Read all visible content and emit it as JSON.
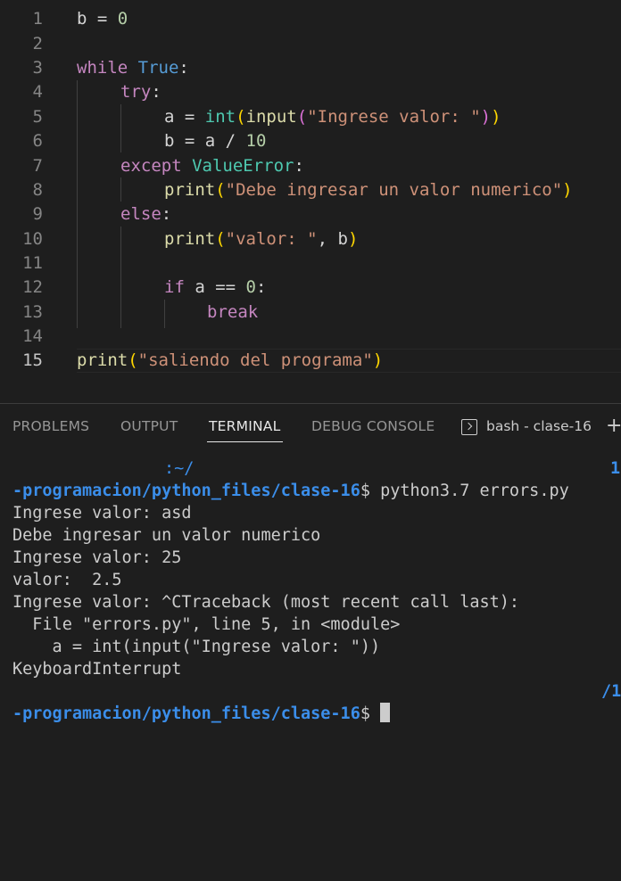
{
  "editor": {
    "line_numbers": [
      "1",
      "2",
      "3",
      "4",
      "5",
      "6",
      "7",
      "8",
      "9",
      "10",
      "11",
      "12",
      "13",
      "14",
      "15"
    ],
    "active_line": "15",
    "lines": {
      "l1": {
        "b": "b",
        "eq": " = ",
        "zero": "0"
      },
      "l3": {
        "kw": "while",
        "sp": " ",
        "true": "True",
        "colon": ":"
      },
      "l4": {
        "kw": "try",
        "colon": ":"
      },
      "l5": {
        "a": "a = ",
        "int": "int",
        "p1": "(",
        "input": "input",
        "p2": "(",
        "str": "\"Ingrese valor: \"",
        "p2c": ")",
        "p1c": ")"
      },
      "l6": {
        "text": "b = a / ",
        "num": "10"
      },
      "l7": {
        "kw": "except",
        "sp": " ",
        "cls": "ValueError",
        "colon": ":"
      },
      "l8": {
        "fn": "print",
        "p1": "(",
        "str": "\"Debe ingresar un valor numerico\"",
        "p1c": ")"
      },
      "l9": {
        "kw": "else",
        "colon": ":"
      },
      "l10": {
        "fn": "print",
        "p1": "(",
        "str": "\"valor: \"",
        "comma": ", b",
        "p1c": ")"
      },
      "l12": {
        "kw": "if",
        "text": " a == ",
        "num": "0",
        "colon": ":"
      },
      "l13": {
        "kw": "break"
      },
      "l15": {
        "fn": "print",
        "p1": "(",
        "str": "\"saliendo del programa\"",
        "p1c": ")"
      }
    }
  },
  "panel": {
    "tabs": [
      "PROBLEMS",
      "OUTPUT",
      "TERMINAL",
      "DEBUG CONSOLE"
    ],
    "active_tab": "TERMINAL",
    "terminal_selector": "bash - clase-16",
    "plus": "+"
  },
  "terminal": {
    "frag_top_left": ":~/",
    "frag_top_right": "1",
    "prompt_path": "-programacion/python_files/clase-16",
    "prompt_symbol": "$ ",
    "command": "python3.7 errors.py",
    "output": [
      "Ingrese valor: asd",
      "Debe ingresar un valor numerico",
      "Ingrese valor: 25",
      "valor:  2.5",
      "Ingrese valor: ^CTraceback (most recent call last):",
      "  File \"errors.py\", line 5, in <module>",
      "    a = int(input(\"Ingrese valor: \"))",
      "KeyboardInterrupt"
    ],
    "frag_bottom_right": "/1",
    "prompt2_path": "-programacion/python_files/clase-16",
    "prompt2_symbol": "$ "
  }
}
